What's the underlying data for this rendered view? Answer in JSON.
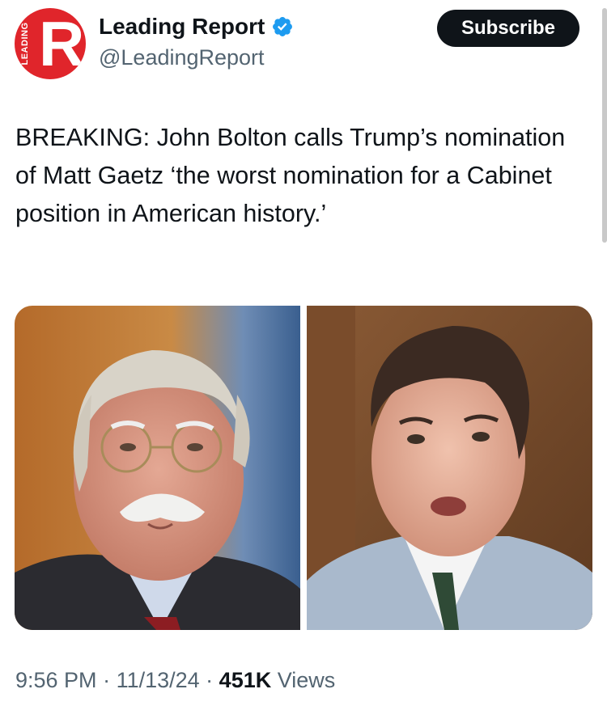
{
  "author": {
    "avatar_text": "LEADING",
    "avatar_letter": "R",
    "display_name": "Leading Report",
    "handle": "@LeadingReport",
    "verified_icon": "verified-badge-icon",
    "brand_color": "#e0252b",
    "verified_color": "#1d9bf0"
  },
  "subscribe_label": "Subscribe",
  "tweet": {
    "text": "BREAKING: John Bolton calls Trump’s nomination of Matt Gaetz ‘the worst nomination for a Cabinet position in American history.’"
  },
  "meta": {
    "time": "9:56 PM",
    "sep1": " · ",
    "date": "11/13/24",
    "sep2": " · ",
    "views_count": "451K",
    "views_label": " Views"
  }
}
